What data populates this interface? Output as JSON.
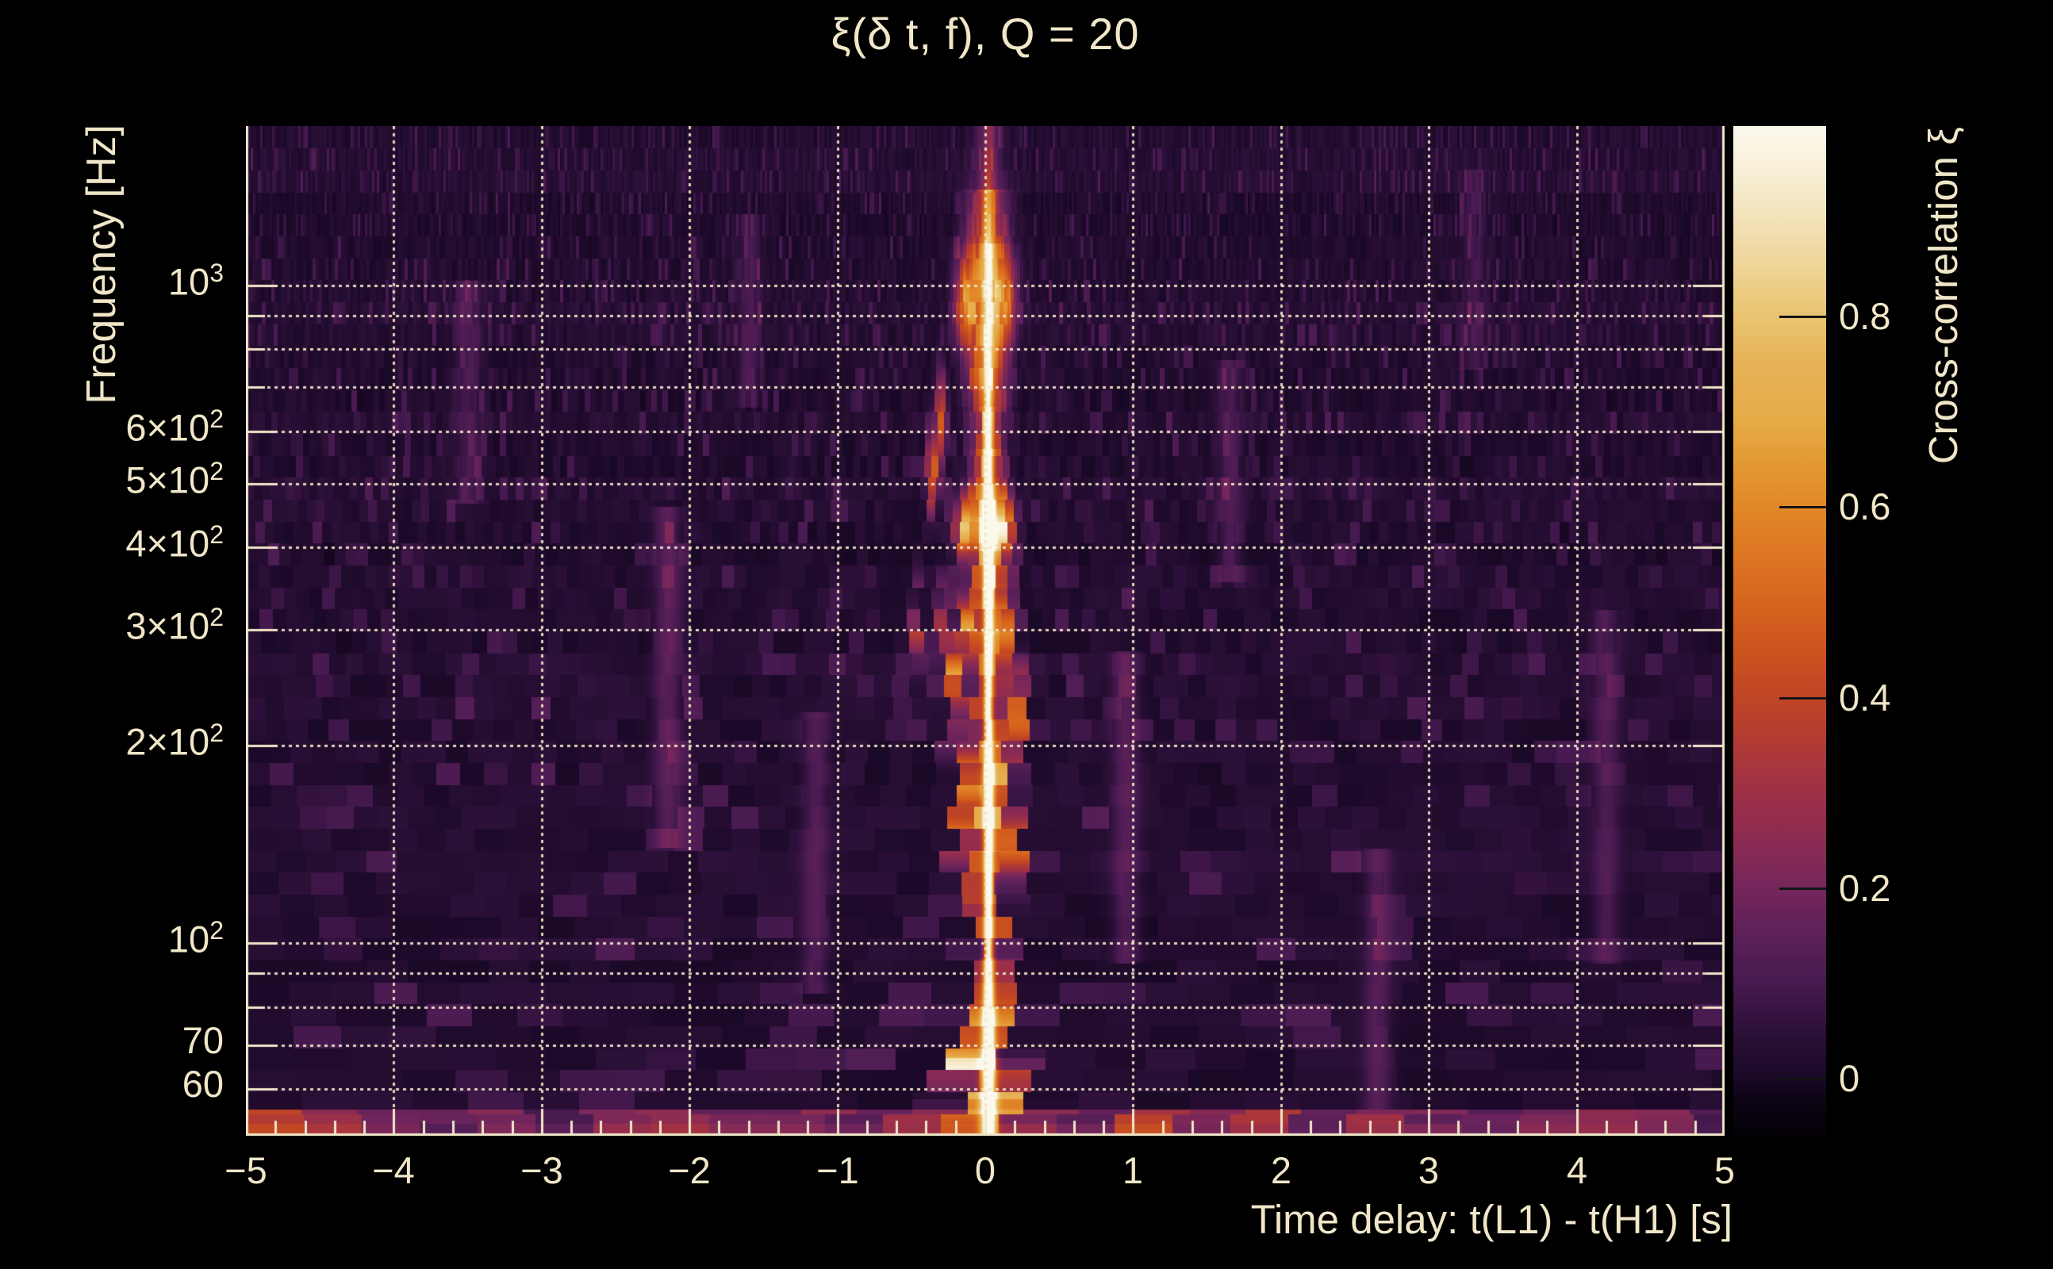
{
  "title": "ξ(δ t, f), Q = 20",
  "colors": {
    "background": "#000000",
    "text": "#f0e6c8",
    "grid": "#f0e6c8",
    "frame": "#f0e6c8",
    "colorbar_tick": "#141414"
  },
  "chart_data": {
    "type": "heatmap",
    "title": "ξ(δ t, f), Q = 20",
    "xlabel": "Time delay: t(L1) - t(H1) [s]",
    "ylabel": "Frequency [Hz]",
    "colorbar_label": "Cross-correlation ξ",
    "x_range": [
      -5,
      5
    ],
    "x_minor_step": 0.2,
    "x_ticks": [
      {
        "v": -5,
        "label": "−5"
      },
      {
        "v": -4,
        "label": "−4"
      },
      {
        "v": -3,
        "label": "−3"
      },
      {
        "v": -2,
        "label": "−2"
      },
      {
        "v": -1,
        "label": "−1"
      },
      {
        "v": 0,
        "label": "0"
      },
      {
        "v": 1,
        "label": "1"
      },
      {
        "v": 2,
        "label": "2"
      },
      {
        "v": 3,
        "label": "3"
      },
      {
        "v": 4,
        "label": "4"
      },
      {
        "v": 5,
        "label": "5"
      }
    ],
    "x_gridlines": [
      -4,
      -3,
      -2,
      -1,
      0,
      1,
      2,
      3,
      4,
      5
    ],
    "y_scale": "log",
    "y_range_hz": [
      51,
      1746
    ],
    "y_gridlines_hz": [
      1000,
      900,
      800,
      700,
      600,
      500,
      400,
      300,
      200,
      100,
      90,
      80,
      70,
      60
    ],
    "y_minor_ticks_hz": [
      900,
      800,
      700,
      90,
      80
    ],
    "y_tick_labels": [
      {
        "hz": 1000,
        "mant": "10",
        "exp": "3"
      },
      {
        "hz": 600,
        "mant": "6×10",
        "exp": "2"
      },
      {
        "hz": 500,
        "mant": "5×10",
        "exp": "2"
      },
      {
        "hz": 400,
        "mant": "4×10",
        "exp": "2"
      },
      {
        "hz": 300,
        "mant": "3×10",
        "exp": "2"
      },
      {
        "hz": 200,
        "mant": "2×10",
        "exp": "2"
      },
      {
        "hz": 100,
        "mant": "10",
        "exp": "2"
      },
      {
        "hz": 70,
        "mant": "70",
        "exp": ""
      },
      {
        "hz": 60,
        "mant": "60",
        "exp": ""
      }
    ],
    "colorbar": {
      "min": -0.06,
      "max": 1.0,
      "ticks": [
        {
          "v": 0.8,
          "label": "0.8"
        },
        {
          "v": 0.6,
          "label": "0.6"
        },
        {
          "v": 0.4,
          "label": "0.4"
        },
        {
          "v": 0.2,
          "label": "0.2"
        },
        {
          "v": 0.0,
          "label": "0"
        }
      ],
      "stops": [
        [
          -0.06,
          "#040106"
        ],
        [
          -0.02,
          "#0d0415"
        ],
        [
          0.0,
          "#190826"
        ],
        [
          0.05,
          "#2c1038"
        ],
        [
          0.1,
          "#471a50"
        ],
        [
          0.15,
          "#5c2059"
        ],
        [
          0.2,
          "#75265b"
        ],
        [
          0.25,
          "#8b2b53"
        ],
        [
          0.3,
          "#9e3046"
        ],
        [
          0.35,
          "#b03a35"
        ],
        [
          0.4,
          "#c04526"
        ],
        [
          0.45,
          "#cd531e"
        ],
        [
          0.5,
          "#d6651e"
        ],
        [
          0.55,
          "#dd7623"
        ],
        [
          0.6,
          "#e18829"
        ],
        [
          0.65,
          "#e49b35"
        ],
        [
          0.7,
          "#e6ae4b"
        ],
        [
          0.75,
          "#e6b257"
        ],
        [
          0.8,
          "#e9c470"
        ],
        [
          0.85,
          "#eed395"
        ],
        [
          0.9,
          "#f3e2b8"
        ],
        [
          0.95,
          "#f8efd6"
        ],
        [
          1.0,
          "#fbf8ec"
        ]
      ]
    },
    "signal": {
      "dt_center_s": 0.02,
      "ridge_profile": [
        {
          "f_lo": 50,
          "f_hi": 58,
          "core_xi": 0.8,
          "core_w_s": 0.05,
          "glow_xi": 0.45,
          "glow_w_s": 0.22
        },
        {
          "f_lo": 58,
          "f_hi": 67,
          "core_xi": 0.95,
          "core_w_s": 0.045,
          "glow_xi": 0.6,
          "glow_w_s": 0.16
        },
        {
          "f_lo": 67,
          "f_hi": 80,
          "core_xi": 0.96,
          "core_w_s": 0.04,
          "glow_xi": 0.55,
          "glow_w_s": 0.12
        },
        {
          "f_lo": 80,
          "f_hi": 95,
          "core_xi": 0.9,
          "core_w_s": 0.034,
          "glow_xi": 0.42,
          "glow_w_s": 0.1
        },
        {
          "f_lo": 95,
          "f_hi": 115,
          "core_xi": 0.86,
          "core_w_s": 0.03,
          "glow_xi": 0.38,
          "glow_w_s": 0.09
        },
        {
          "f_lo": 115,
          "f_hi": 138,
          "core_xi": 0.84,
          "core_w_s": 0.03,
          "glow_xi": 0.45,
          "glow_w_s": 0.1
        },
        {
          "f_lo": 138,
          "f_hi": 162,
          "core_xi": 0.88,
          "core_w_s": 0.032,
          "glow_xi": 0.52,
          "glow_w_s": 0.11
        },
        {
          "f_lo": 162,
          "f_hi": 188,
          "core_xi": 0.9,
          "core_w_s": 0.034,
          "glow_xi": 0.55,
          "glow_w_s": 0.11
        },
        {
          "f_lo": 188,
          "f_hi": 218,
          "core_xi": 0.84,
          "core_w_s": 0.03,
          "glow_xi": 0.48,
          "glow_w_s": 0.1
        },
        {
          "f_lo": 218,
          "f_hi": 255,
          "core_xi": 0.8,
          "core_w_s": 0.028,
          "glow_xi": 0.42,
          "glow_w_s": 0.11
        },
        {
          "f_lo": 255,
          "f_hi": 295,
          "core_xi": 0.82,
          "core_w_s": 0.028,
          "glow_xi": 0.48,
          "glow_w_s": 0.1
        },
        {
          "f_lo": 295,
          "f_hi": 345,
          "core_xi": 0.86,
          "core_w_s": 0.03,
          "glow_xi": 0.52,
          "glow_w_s": 0.1
        },
        {
          "f_lo": 345,
          "f_hi": 395,
          "core_xi": 0.9,
          "core_w_s": 0.032,
          "glow_xi": 0.58,
          "glow_w_s": 0.1
        },
        {
          "f_lo": 395,
          "f_hi": 445,
          "core_xi": 0.95,
          "core_w_s": 0.035,
          "glow_xi": 0.66,
          "glow_w_s": 0.11
        },
        {
          "f_lo": 445,
          "f_hi": 500,
          "core_xi": 0.92,
          "core_w_s": 0.034,
          "glow_xi": 0.6,
          "glow_w_s": 0.11
        },
        {
          "f_lo": 500,
          "f_hi": 565,
          "core_xi": 0.84,
          "core_w_s": 0.03,
          "glow_xi": 0.5,
          "glow_w_s": 0.1
        },
        {
          "f_lo": 565,
          "f_hi": 655,
          "core_xi": 0.7,
          "core_w_s": 0.028,
          "glow_xi": 0.4,
          "glow_w_s": 0.1
        },
        {
          "f_lo": 655,
          "f_hi": 790,
          "core_xi": 0.55,
          "core_w_s": 0.03,
          "glow_xi": 0.32,
          "glow_w_s": 0.12
        },
        {
          "f_lo": 790,
          "f_hi": 960,
          "core_xi": 0.5,
          "core_w_s": 0.034,
          "glow_xi": 0.3,
          "glow_w_s": 0.13
        },
        {
          "f_lo": 960,
          "f_hi": 1160,
          "core_xi": 0.54,
          "core_w_s": 0.038,
          "glow_xi": 0.32,
          "glow_w_s": 0.13
        },
        {
          "f_lo": 1160,
          "f_hi": 1400,
          "core_xi": 0.38,
          "core_w_s": 0.04,
          "glow_xi": 0.22,
          "glow_w_s": 0.12
        },
        {
          "f_lo": 1400,
          "f_hi": 1750,
          "core_xi": 0.16,
          "core_w_s": 0.04,
          "glow_xi": 0.08,
          "glow_w_s": 0.1
        }
      ],
      "blobs": [
        {
          "dt": -0.13,
          "f": 950,
          "sdt": 0.05,
          "slogf": 0.045,
          "xi": 0.42
        },
        {
          "dt": 0.13,
          "f": 950,
          "sdt": 0.05,
          "slogf": 0.045,
          "xi": 0.4
        },
        {
          "dt": -0.3,
          "f": 620,
          "sdt": 0.025,
          "slogf": 0.05,
          "xi": 0.45
        },
        {
          "dt": -0.36,
          "f": 520,
          "sdt": 0.025,
          "slogf": 0.04,
          "xi": 0.45
        },
        {
          "dt": -0.13,
          "f": 430,
          "sdt": 0.05,
          "slogf": 0.03,
          "xi": 0.62
        },
        {
          "dt": 0.12,
          "f": 430,
          "sdt": 0.05,
          "slogf": 0.03,
          "xi": 0.6
        },
        {
          "dt": -0.28,
          "f": 300,
          "sdt": 0.025,
          "slogf": 0.05,
          "xi": 0.45
        },
        {
          "dt": -0.46,
          "f": 310,
          "sdt": 0.02,
          "slogf": 0.04,
          "xi": 0.34
        },
        {
          "dt": -0.12,
          "f": 300,
          "sdt": 0.04,
          "slogf": 0.03,
          "xi": 0.58
        },
        {
          "dt": 0.12,
          "f": 300,
          "sdt": 0.04,
          "slogf": 0.03,
          "xi": 0.56
        },
        {
          "dt": -0.2,
          "f": 252,
          "sdt": 0.03,
          "slogf": 0.03,
          "xi": 0.52
        },
        {
          "dt": 0.2,
          "f": 252,
          "sdt": 0.03,
          "slogf": 0.03,
          "xi": 0.5
        },
        {
          "dt": -0.23,
          "f": 215,
          "sdt": 0.028,
          "slogf": 0.03,
          "xi": 0.46
        },
        {
          "dt": 0.22,
          "f": 215,
          "sdt": 0.028,
          "slogf": 0.03,
          "xi": 0.44
        },
        {
          "dt": -0.14,
          "f": 176,
          "sdt": 0.04,
          "slogf": 0.03,
          "xi": 0.6
        },
        {
          "dt": 0.14,
          "f": 176,
          "sdt": 0.04,
          "slogf": 0.03,
          "xi": 0.58
        },
        {
          "dt": -0.17,
          "f": 142,
          "sdt": 0.035,
          "slogf": 0.03,
          "xi": 0.52
        },
        {
          "dt": 0.17,
          "f": 142,
          "sdt": 0.035,
          "slogf": 0.03,
          "xi": 0.5
        },
        {
          "dt": -0.12,
          "f": 64,
          "sdt": 0.06,
          "slogf": 0.035,
          "xi": 0.6
        },
        {
          "dt": 0.1,
          "f": 72,
          "sdt": 0.05,
          "slogf": 0.03,
          "xi": 0.5
        },
        {
          "dt": 0.0,
          "f": 1050,
          "sdt": 0.1,
          "slogf": 0.09,
          "xi": 0.22
        },
        {
          "dt": 0.0,
          "f": 760,
          "sdt": 0.07,
          "slogf": 0.05,
          "xi": 0.25
        }
      ],
      "streaks": [
        {
          "dt": -3.5,
          "f1": 500,
          "f2": 950,
          "xi": 0.09
        },
        {
          "dt": -2.15,
          "f1": 150,
          "f2": 430,
          "xi": 0.12
        },
        {
          "dt": -1.6,
          "f1": 700,
          "f2": 1200,
          "xi": 0.08
        },
        {
          "dt": -1.15,
          "f1": 90,
          "f2": 210,
          "xi": 0.1
        },
        {
          "dt": 0.95,
          "f1": 100,
          "f2": 260,
          "xi": 0.11
        },
        {
          "dt": 1.65,
          "f1": 380,
          "f2": 720,
          "xi": 0.09
        },
        {
          "dt": 2.65,
          "f1": 60,
          "f2": 130,
          "xi": 0.1
        },
        {
          "dt": 3.3,
          "f1": 800,
          "f2": 1400,
          "xi": 0.07
        },
        {
          "dt": 4.2,
          "f1": 100,
          "f2": 300,
          "xi": 0.09
        }
      ],
      "bottom_band": {
        "f_max_hz": 56,
        "base_xi": 0.09,
        "patches": [
          [
            -4.78,
            0.28
          ],
          [
            -4.45,
            0.16
          ],
          [
            -3.9,
            0.13
          ],
          [
            -3.3,
            0.1
          ],
          [
            -2.6,
            0.12
          ],
          [
            -2.15,
            0.15
          ],
          [
            -1.55,
            0.1
          ],
          [
            -1.05,
            0.12
          ],
          [
            -0.5,
            0.17
          ],
          [
            0.5,
            0.14
          ],
          [
            1.12,
            0.26
          ],
          [
            1.55,
            0.12
          ],
          [
            1.95,
            0.22
          ],
          [
            2.6,
            0.18
          ],
          [
            3.15,
            0.1
          ],
          [
            3.7,
            0.12
          ],
          [
            4.15,
            0.14
          ],
          [
            4.6,
            0.11
          ]
        ]
      }
    },
    "noise": {
      "rows": 46,
      "base_xi": 0.03,
      "streak_prob": 0.16
    }
  }
}
